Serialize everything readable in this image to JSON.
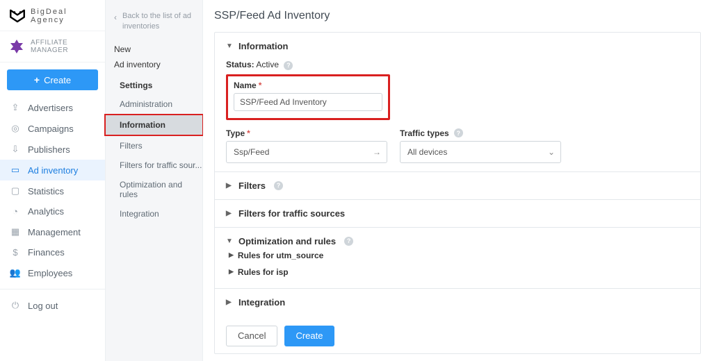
{
  "brand": {
    "name": "BigDeal",
    "subtitle": "Agency"
  },
  "role": "AFFILIATE MANAGER",
  "create_button": "Create",
  "nav": {
    "advertisers": "Advertisers",
    "campaigns": "Campaigns",
    "publishers": "Publishers",
    "ad_inventory": "Ad inventory",
    "statistics": "Statistics",
    "analytics": "Analytics",
    "management": "Management",
    "finances": "Finances",
    "employees": "Employees",
    "logout": "Log out"
  },
  "subnav": {
    "back": "Back to the list of ad inventories",
    "new": "New",
    "ad_inventory": "Ad inventory",
    "settings": "Settings",
    "items": {
      "administration": "Administration",
      "information": "Information",
      "filters": "Filters",
      "filters_ts": "Filters for traffic sour...",
      "opt_rules": "Optimization and rules",
      "integration": "Integration"
    }
  },
  "page": {
    "title": "SSP/Feed Ad Inventory",
    "sections": {
      "information": "Information",
      "filters": "Filters",
      "filters_ts": "Filters for traffic sources",
      "opt_rules": "Optimization and rules",
      "integration": "Integration"
    },
    "status_label": "Status:",
    "status_value": "Active",
    "name_label": "Name",
    "name_value": "SSP/Feed Ad Inventory",
    "type_label": "Type",
    "type_value": "Ssp/Feed",
    "traffic_label": "Traffic types",
    "traffic_value": "All devices",
    "rules_utm": "Rules for utm_source",
    "rules_isp": "Rules for isp",
    "cancel": "Cancel",
    "create": "Create"
  }
}
